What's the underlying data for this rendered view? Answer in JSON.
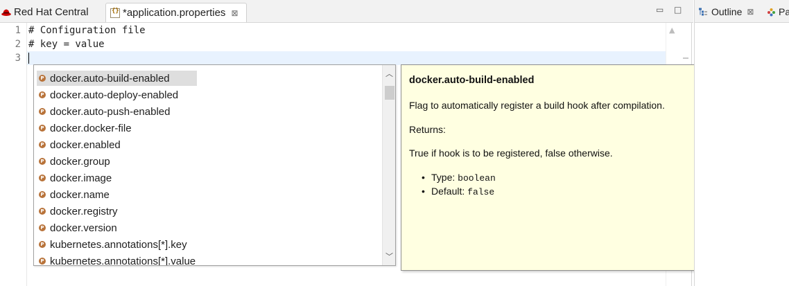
{
  "tabs": [
    {
      "label": "Red Hat Central",
      "icon": "redhat-icon",
      "active": false
    },
    {
      "label": "*application.properties",
      "icon": "properties-file-icon",
      "active": true,
      "close": "⊠"
    }
  ],
  "window_buttons": {
    "minimize": "▭",
    "maximize": "□"
  },
  "editor": {
    "lines": [
      {
        "num": "1",
        "text": "# Configuration file"
      },
      {
        "num": "2",
        "text": "# key = value"
      },
      {
        "num": "3",
        "text": ""
      }
    ],
    "scroll_up": "▲"
  },
  "completion": {
    "items": [
      "docker.auto-build-enabled",
      "docker.auto-deploy-enabled",
      "docker.auto-push-enabled",
      "docker.docker-file",
      "docker.enabled",
      "docker.group",
      "docker.image",
      "docker.name",
      "docker.registry",
      "docker.version",
      "kubernetes.annotations[*].key",
      "kubernetes.annotations[*].value"
    ],
    "selected_index": 0,
    "scroll_up": "︿",
    "scroll_down": "﹀"
  },
  "doc": {
    "title": "docker.auto-build-enabled",
    "description": "Flag to automatically register a build hook after compilation.",
    "returns_label": "Returns:",
    "returns_text": "True if hook is to be registered, false otherwise.",
    "type_label": "Type: ",
    "type_value": "boolean",
    "default_label": "Default: ",
    "default_value": "false"
  },
  "side": {
    "outline_label": "Outline",
    "outline_close": "⊠",
    "palette_label": "Pa"
  },
  "colors": {
    "doc_background": "#ffffe1",
    "current_line": "#e8f2fe",
    "property_icon": "#b8733a"
  }
}
